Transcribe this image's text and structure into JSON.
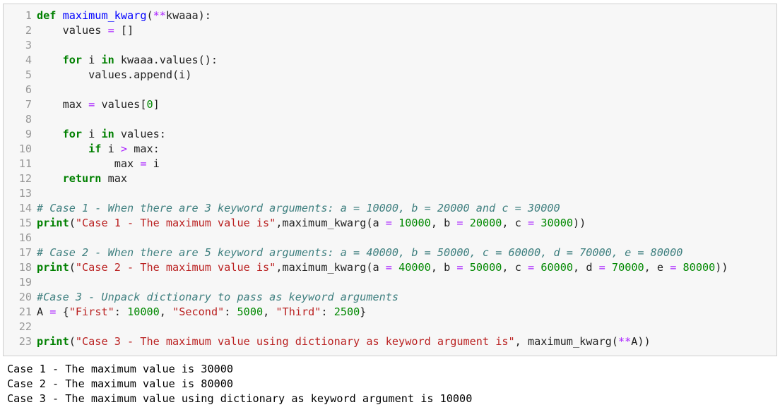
{
  "colors": {
    "cell_background": "#f7f7f7",
    "cell_border": "#cfcfcf",
    "line_number": "#999999",
    "keyword": "#008000",
    "function_name": "#0000ff",
    "number": "#008800",
    "string": "#ba2121",
    "operator": "#aa22ff",
    "comment": "#408080"
  },
  "code_lines": [
    {
      "num": "1",
      "tokens": [
        {
          "t": "def",
          "c": "kw"
        },
        {
          "t": " "
        },
        {
          "t": "maximum_kwarg",
          "c": "fn"
        },
        {
          "t": "("
        },
        {
          "t": "**",
          "c": "op"
        },
        {
          "t": "kwaaa):"
        }
      ]
    },
    {
      "num": "2",
      "tokens": [
        {
          "t": "    values "
        },
        {
          "t": "=",
          "c": "op"
        },
        {
          "t": " []"
        }
      ]
    },
    {
      "num": "3",
      "tokens": []
    },
    {
      "num": "4",
      "tokens": [
        {
          "t": "    "
        },
        {
          "t": "for",
          "c": "kw"
        },
        {
          "t": " i "
        },
        {
          "t": "in",
          "c": "kw"
        },
        {
          "t": " kwaaa.values():"
        }
      ]
    },
    {
      "num": "5",
      "tokens": [
        {
          "t": "        values.append(i)"
        }
      ]
    },
    {
      "num": "6",
      "tokens": []
    },
    {
      "num": "7",
      "tokens": [
        {
          "t": "    max "
        },
        {
          "t": "=",
          "c": "op"
        },
        {
          "t": " values["
        },
        {
          "t": "0",
          "c": "num"
        },
        {
          "t": "]"
        }
      ]
    },
    {
      "num": "8",
      "tokens": []
    },
    {
      "num": "9",
      "tokens": [
        {
          "t": "    "
        },
        {
          "t": "for",
          "c": "kw"
        },
        {
          "t": " i "
        },
        {
          "t": "in",
          "c": "kw"
        },
        {
          "t": " values:"
        }
      ]
    },
    {
      "num": "10",
      "tokens": [
        {
          "t": "        "
        },
        {
          "t": "if",
          "c": "kw"
        },
        {
          "t": " i "
        },
        {
          "t": ">",
          "c": "op"
        },
        {
          "t": " max:"
        }
      ]
    },
    {
      "num": "11",
      "tokens": [
        {
          "t": "            max "
        },
        {
          "t": "=",
          "c": "op"
        },
        {
          "t": " i"
        }
      ]
    },
    {
      "num": "12",
      "tokens": [
        {
          "t": "    "
        },
        {
          "t": "return",
          "c": "kw"
        },
        {
          "t": " max"
        }
      ]
    },
    {
      "num": "13",
      "tokens": []
    },
    {
      "num": "14",
      "tokens": [
        {
          "t": "# Case 1 - When there are 3 keyword arguments: a = 10000, b = 20000 and c = 30000",
          "c": "cm"
        }
      ]
    },
    {
      "num": "15",
      "tokens": [
        {
          "t": "print",
          "c": "kw"
        },
        {
          "t": "("
        },
        {
          "t": "\"Case 1 - The maximum value is\"",
          "c": "str"
        },
        {
          "t": ",maximum_kwarg(a "
        },
        {
          "t": "=",
          "c": "op"
        },
        {
          "t": " "
        },
        {
          "t": "10000",
          "c": "num"
        },
        {
          "t": ", b "
        },
        {
          "t": "=",
          "c": "op"
        },
        {
          "t": " "
        },
        {
          "t": "20000",
          "c": "num"
        },
        {
          "t": ", c "
        },
        {
          "t": "=",
          "c": "op"
        },
        {
          "t": " "
        },
        {
          "t": "30000",
          "c": "num"
        },
        {
          "t": "))"
        }
      ]
    },
    {
      "num": "16",
      "tokens": []
    },
    {
      "num": "17",
      "tokens": [
        {
          "t": "# Case 2 - When there are 5 keyword arguments: a = 40000, b = 50000, c = 60000, d = 70000, e = 80000",
          "c": "cm"
        }
      ]
    },
    {
      "num": "18",
      "tokens": [
        {
          "t": "print",
          "c": "kw"
        },
        {
          "t": "("
        },
        {
          "t": "\"Case 2 - The maximum value is\"",
          "c": "str"
        },
        {
          "t": ",maximum_kwarg(a "
        },
        {
          "t": "=",
          "c": "op"
        },
        {
          "t": " "
        },
        {
          "t": "40000",
          "c": "num"
        },
        {
          "t": ", b "
        },
        {
          "t": "=",
          "c": "op"
        },
        {
          "t": " "
        },
        {
          "t": "50000",
          "c": "num"
        },
        {
          "t": ", c "
        },
        {
          "t": "=",
          "c": "op"
        },
        {
          "t": " "
        },
        {
          "t": "60000",
          "c": "num"
        },
        {
          "t": ", d "
        },
        {
          "t": "=",
          "c": "op"
        },
        {
          "t": " "
        },
        {
          "t": "70000",
          "c": "num"
        },
        {
          "t": ", e "
        },
        {
          "t": "=",
          "c": "op"
        },
        {
          "t": " "
        },
        {
          "t": "80000",
          "c": "num"
        },
        {
          "t": "))"
        }
      ]
    },
    {
      "num": "19",
      "tokens": []
    },
    {
      "num": "20",
      "tokens": [
        {
          "t": "#Case 3 - Unpack dictionary to pass as keyword arguments",
          "c": "cm"
        }
      ]
    },
    {
      "num": "21",
      "tokens": [
        {
          "t": "A "
        },
        {
          "t": "=",
          "c": "op"
        },
        {
          "t": " {"
        },
        {
          "t": "\"First\"",
          "c": "str"
        },
        {
          "t": ": "
        },
        {
          "t": "10000",
          "c": "num"
        },
        {
          "t": ", "
        },
        {
          "t": "\"Second\"",
          "c": "str"
        },
        {
          "t": ": "
        },
        {
          "t": "5000",
          "c": "num"
        },
        {
          "t": ", "
        },
        {
          "t": "\"Third\"",
          "c": "str"
        },
        {
          "t": ": "
        },
        {
          "t": "2500",
          "c": "num"
        },
        {
          "t": "}"
        }
      ]
    },
    {
      "num": "22",
      "tokens": []
    },
    {
      "num": "23",
      "tokens": [
        {
          "t": "print",
          "c": "kw"
        },
        {
          "t": "("
        },
        {
          "t": "\"Case 3 - The maximum value using dictionary as keyword argument is\"",
          "c": "str"
        },
        {
          "t": ", maximum_kwarg("
        },
        {
          "t": "**",
          "c": "op"
        },
        {
          "t": "A))"
        }
      ]
    }
  ],
  "output_lines": [
    "Case 1 - The maximum value is 30000",
    "Case 2 - The maximum value is 80000",
    "Case 3 - The maximum value using dictionary as keyword argument is 10000"
  ]
}
